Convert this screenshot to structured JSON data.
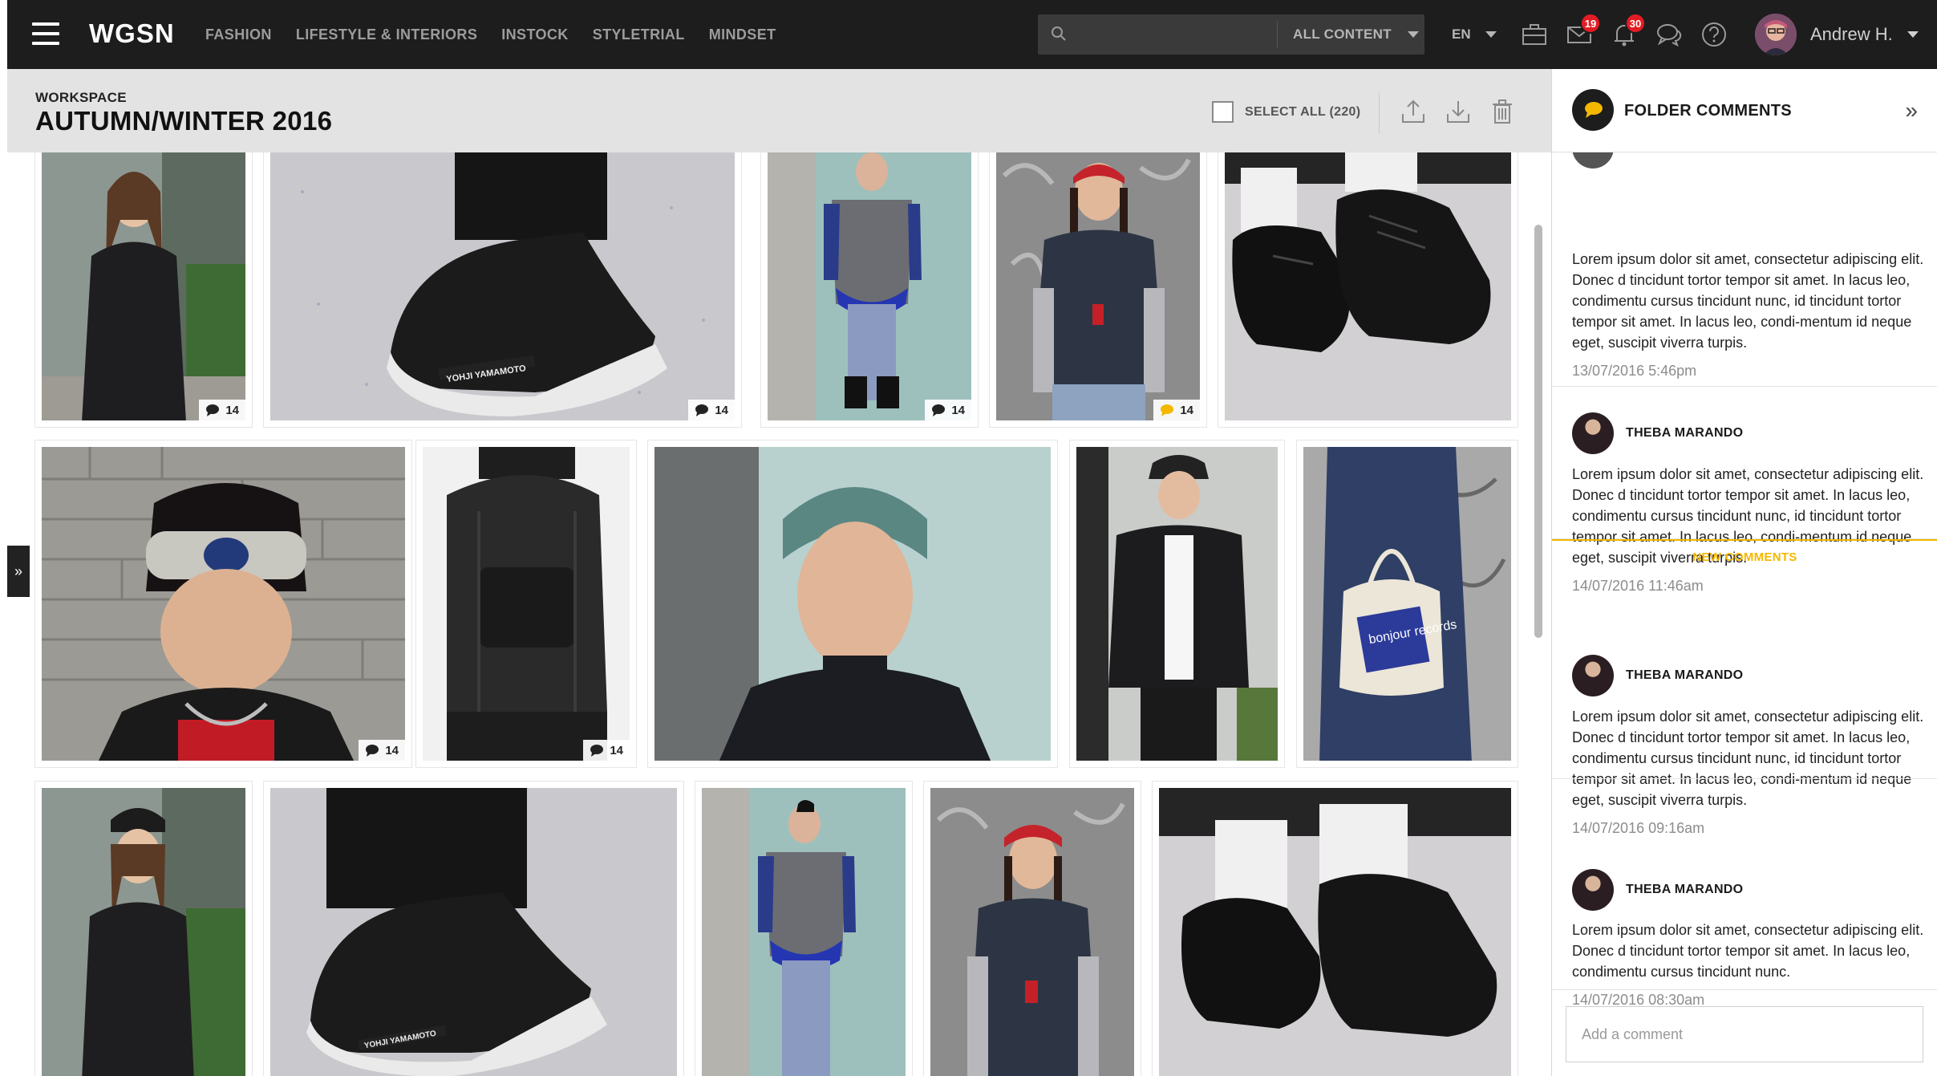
{
  "brand": {
    "logo": "WGSN"
  },
  "nav": {
    "items": [
      "FASHION",
      "LIFESTYLE & INTERIORS",
      "INSTOCK",
      "STYLETRIAL",
      "MINDSET"
    ]
  },
  "search": {
    "placeholder": "",
    "scope": "ALL CONTENT"
  },
  "lang": "EN",
  "notifications": {
    "messages_count": "19",
    "alerts_count": "30"
  },
  "user": {
    "name": "Andrew H."
  },
  "workspace": {
    "label": "WORKSPACE",
    "title": "AUTUMN/WINTER 2016",
    "select_all": "SELECT ALL (220)"
  },
  "tiles": [
    {
      "subject": "woman in black oversized dress",
      "comments": "14"
    },
    {
      "subject": "Y-3 sneaker close-up",
      "comments": "14"
    },
    {
      "subject": "man in grey apron top",
      "comments": "14"
    },
    {
      "subject": "girl with braids and red headband",
      "comments": "14",
      "comment_highlight": true
    },
    {
      "subject": "black leather shoes close-up",
      "comments": ""
    },
    {
      "subject": "man with headband",
      "comments": "14"
    },
    {
      "subject": "black backpack",
      "comments": "14"
    },
    {
      "subject": "man with teal hair portrait",
      "comments": ""
    },
    {
      "subject": "man in leather jacket and cap",
      "comments": ""
    },
    {
      "subject": "denim coat with tote bag",
      "comments": ""
    },
    {
      "subject": "woman in black oversized dress",
      "comments": ""
    },
    {
      "subject": "Y-3 sneaker close-up",
      "comments": ""
    },
    {
      "subject": "man in grey apron top",
      "comments": ""
    },
    {
      "subject": "girl with braids and red headband",
      "comments": ""
    },
    {
      "subject": "black leather shoes close-up",
      "comments": ""
    }
  ],
  "shoe_brand_text": "YOHJI YAMAMOTO",
  "tote_text": "bonjour records",
  "panel": {
    "title": "FOLDER COMMENTS",
    "new_comments_label": "NEW COMMENTS",
    "add_comment_placeholder": "Add a comment",
    "comments": [
      {
        "author": "",
        "text": "Lorem ipsum dolor sit amet, consectetur adipiscing elit. Donec d tincidunt tortor tempor sit amet. In lacus leo, condimentu cursus tincidunt nunc, id tincidunt tortor tempor sit amet. In lacus leo, condi-mentum id neque eget, suscipit viverra turpis.",
        "date": "13/07/2016 5:46pm"
      },
      {
        "author": "THEBA MARANDO",
        "text": "Lorem ipsum dolor sit amet, consectetur adipiscing elit. Donec d tincidunt tortor tempor sit amet. In lacus leo, condimentu cursus tincidunt nunc, id tincidunt tortor tempor sit amet. In lacus leo, condi-mentum id neque eget, suscipit viverra turpis.",
        "date": "14/07/2016 11:46am"
      },
      {
        "author": "THEBA MARANDO",
        "text": "Lorem ipsum dolor sit amet, consectetur adipiscing elit. Donec d tincidunt tortor tempor sit amet. In lacus leo, condimentu cursus tincidunt nunc, id tincidunt tortor tempor sit amet. In lacus leo, condi-mentum id neque eget, suscipit viverra turpis.",
        "date": "14/07/2016 09:16am"
      },
      {
        "author": "THEBA MARANDO",
        "text": "Lorem ipsum dolor sit amet, consectetur adipiscing elit. Donec d tincidunt tortor tempor sit amet. In lacus leo, condimentu cursus tincidunt nunc.",
        "date": "14/07/2016 08:30am"
      }
    ]
  },
  "colors": {
    "topbar": "#1d1d1d",
    "badge": "#e21c24",
    "accent_new": "#f4b800",
    "workspace_header": "#e3e3e3"
  },
  "icons": [
    "hamburger-icon",
    "search-icon",
    "briefcase-icon",
    "mail-icon",
    "bell-icon",
    "chat-icon",
    "help-icon",
    "upload-icon",
    "download-icon",
    "trash-icon",
    "comment-icon",
    "collapse-icon"
  ]
}
